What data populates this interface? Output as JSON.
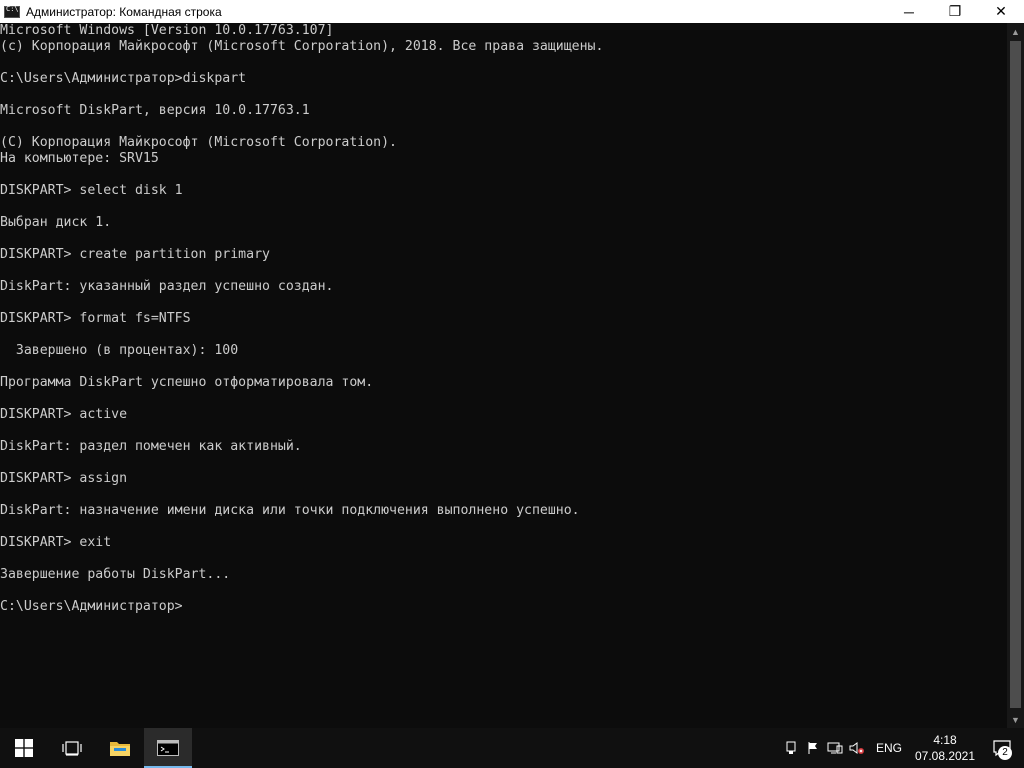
{
  "window": {
    "title": "Администратор: Командная строка",
    "minimize_glyph": "─",
    "maximize_glyph": "❐",
    "close_glyph": "✕"
  },
  "console": {
    "lines": [
      "Microsoft Windows [Version 10.0.17763.107]",
      "(c) Корпорация Майкрософт (Microsoft Corporation), 2018. Все права защищены.",
      "",
      "C:\\Users\\Администратор>diskpart",
      "",
      "Microsoft DiskPart, версия 10.0.17763.1",
      "",
      "(C) Корпорация Майкрософт (Microsoft Corporation).",
      "На компьютере: SRV15",
      "",
      "DISKPART> select disk 1",
      "",
      "Выбран диск 1.",
      "",
      "DISKPART> create partition primary",
      "",
      "DiskPart: указанный раздел успешно создан.",
      "",
      "DISKPART> format fs=NTFS",
      "",
      "  Завершено (в процентах): 100",
      "",
      "Программа DiskPart успешно отформатировала том.",
      "",
      "DISKPART> active",
      "",
      "DiskPart: раздел помечен как активный.",
      "",
      "DISKPART> assign",
      "",
      "DiskPart: назначение имени диска или точки подключения выполнено успешно.",
      "",
      "DISKPART> exit",
      "",
      "Завершение работы DiskPart...",
      "",
      "C:\\Users\\Администратор>"
    ]
  },
  "taskbar": {
    "language": "ENG",
    "time": "4:18",
    "date": "07.08.2021",
    "notification_count": "2",
    "icons": {
      "start": "windows-start-icon",
      "task_view": "task-view-icon",
      "explorer": "file-explorer-icon",
      "cmd": "command-prompt-icon",
      "tray_network": "network-icon",
      "tray_volume": "volume-muted-icon",
      "tray_flag": "action-center-flag-icon"
    }
  }
}
